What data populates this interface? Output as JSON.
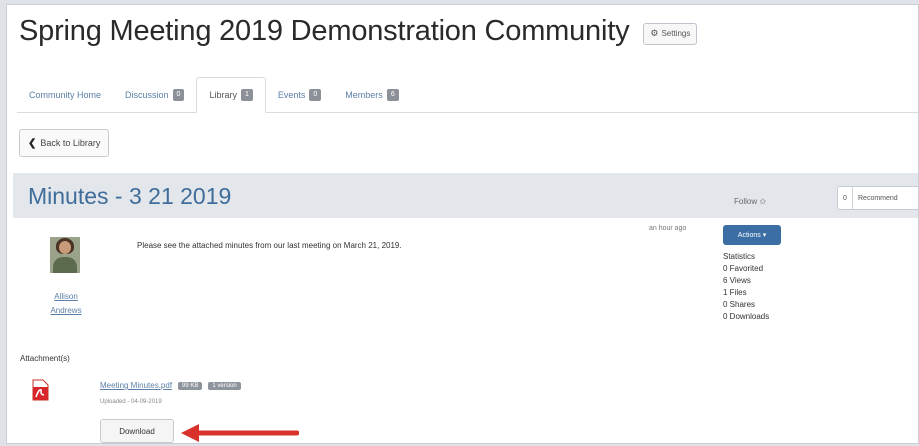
{
  "community": {
    "title": "Spring Meeting 2019 Demonstration Community",
    "settings_label": "Settings"
  },
  "tabs": [
    {
      "label": "Community Home",
      "badge": ""
    },
    {
      "label": "Discussion",
      "badge": "0"
    },
    {
      "label": "Library",
      "badge": "1"
    },
    {
      "label": "Events",
      "badge": "0"
    },
    {
      "label": "Members",
      "badge": "6"
    }
  ],
  "active_tab": "Library",
  "back_button": "Back to Library",
  "document": {
    "title": "Minutes - 3 21 2019",
    "follow_label": "Follow",
    "recommend_count": "0",
    "recommend_label": "Recommend",
    "author_first": "Allison",
    "author_last": "Andrews",
    "body": "Please see the attached minutes from our last meeting on March 21, 2019.",
    "timestamp": "an hour ago",
    "actions_label": "Actions",
    "stats_heading": "Statistics",
    "stats": [
      "0 Favorited",
      "6 Views",
      "1 Files",
      "0 Shares",
      "0 Downloads"
    ]
  },
  "attachments": {
    "label": "Attachment(s)",
    "file_name": "Meeting Minutes.pdf",
    "file_size": "99 KB",
    "file_pages": "1 version",
    "uploaded": "Uploaded - 04-09-2019",
    "download_label": "Download"
  },
  "colors": {
    "link": "#5b7fa6",
    "title_blue": "#3f6d9b",
    "actions_blue": "#3a6ea5",
    "arrow_red": "#d8322b"
  }
}
